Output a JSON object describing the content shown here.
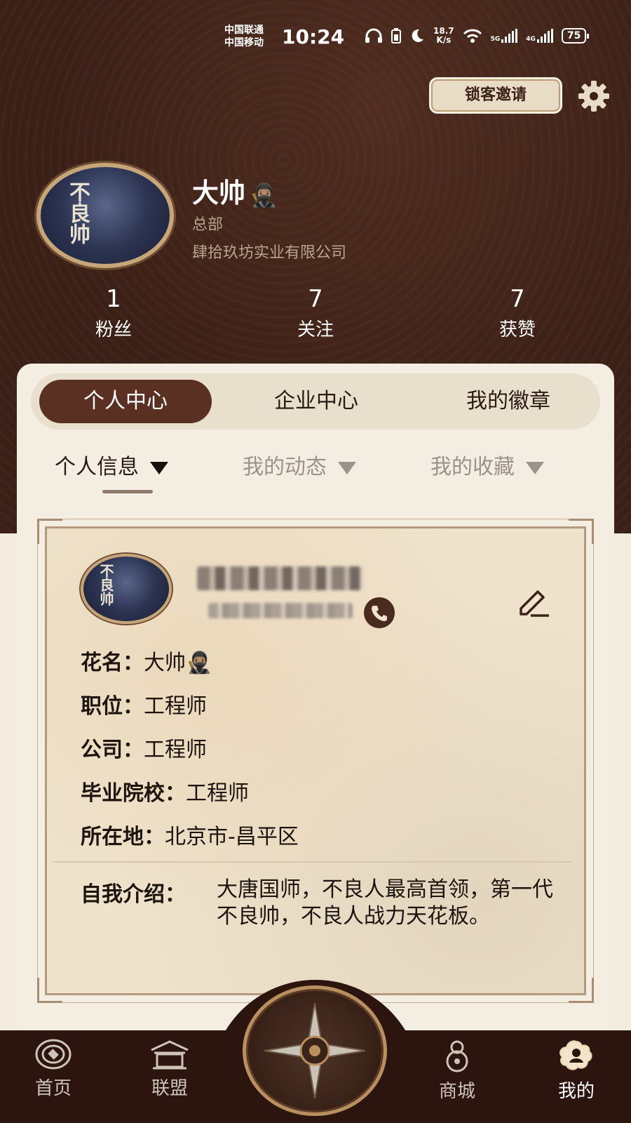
{
  "status_bar": {
    "carrier_1": "中国联通",
    "carrier_2": "中国移动",
    "time": "10:24",
    "net_speed_value": "18.7",
    "net_speed_unit": "K/s",
    "net_1": "5G",
    "net_2": "4G",
    "battery": "75"
  },
  "header": {
    "invite_button": "锁客邀请",
    "name": "大帅",
    "name_emoji": "🥷🏽",
    "department": "总部",
    "company": "肆拾玖坊实业有限公司",
    "avatar_text": "不良帅"
  },
  "stats": [
    {
      "value": "1",
      "label": "粉丝"
    },
    {
      "value": "7",
      "label": "关注"
    },
    {
      "value": "7",
      "label": "获赞"
    }
  ],
  "segments": [
    "个人中心",
    "企业中心",
    "我的徽章"
  ],
  "subtabs": [
    "个人信息",
    "我的动态",
    "我的收藏"
  ],
  "profile": {
    "rows": [
      {
        "key": "花名：",
        "value": "大帅🥷🏽"
      },
      {
        "key": "职位：",
        "value": "工程师"
      },
      {
        "key": "公司：",
        "value": "工程师"
      },
      {
        "key": "毕业院校：",
        "value": "工程师"
      },
      {
        "key": "所在地：",
        "value": "北京市-昌平区"
      }
    ],
    "intro_key": "自我介绍：",
    "intro_value": "大唐国师，不良人最高首领，第一代不良帅，不良人战力天花板。"
  },
  "bottom_nav": [
    {
      "label": "首页"
    },
    {
      "label": "联盟"
    },
    {
      "label": "商城"
    },
    {
      "label": "我的"
    }
  ],
  "colors": {
    "header_bg": "#3b2118",
    "accent": "#5a3022",
    "card_bg": "#f4eee2",
    "nav_bg": "#2b150e"
  }
}
